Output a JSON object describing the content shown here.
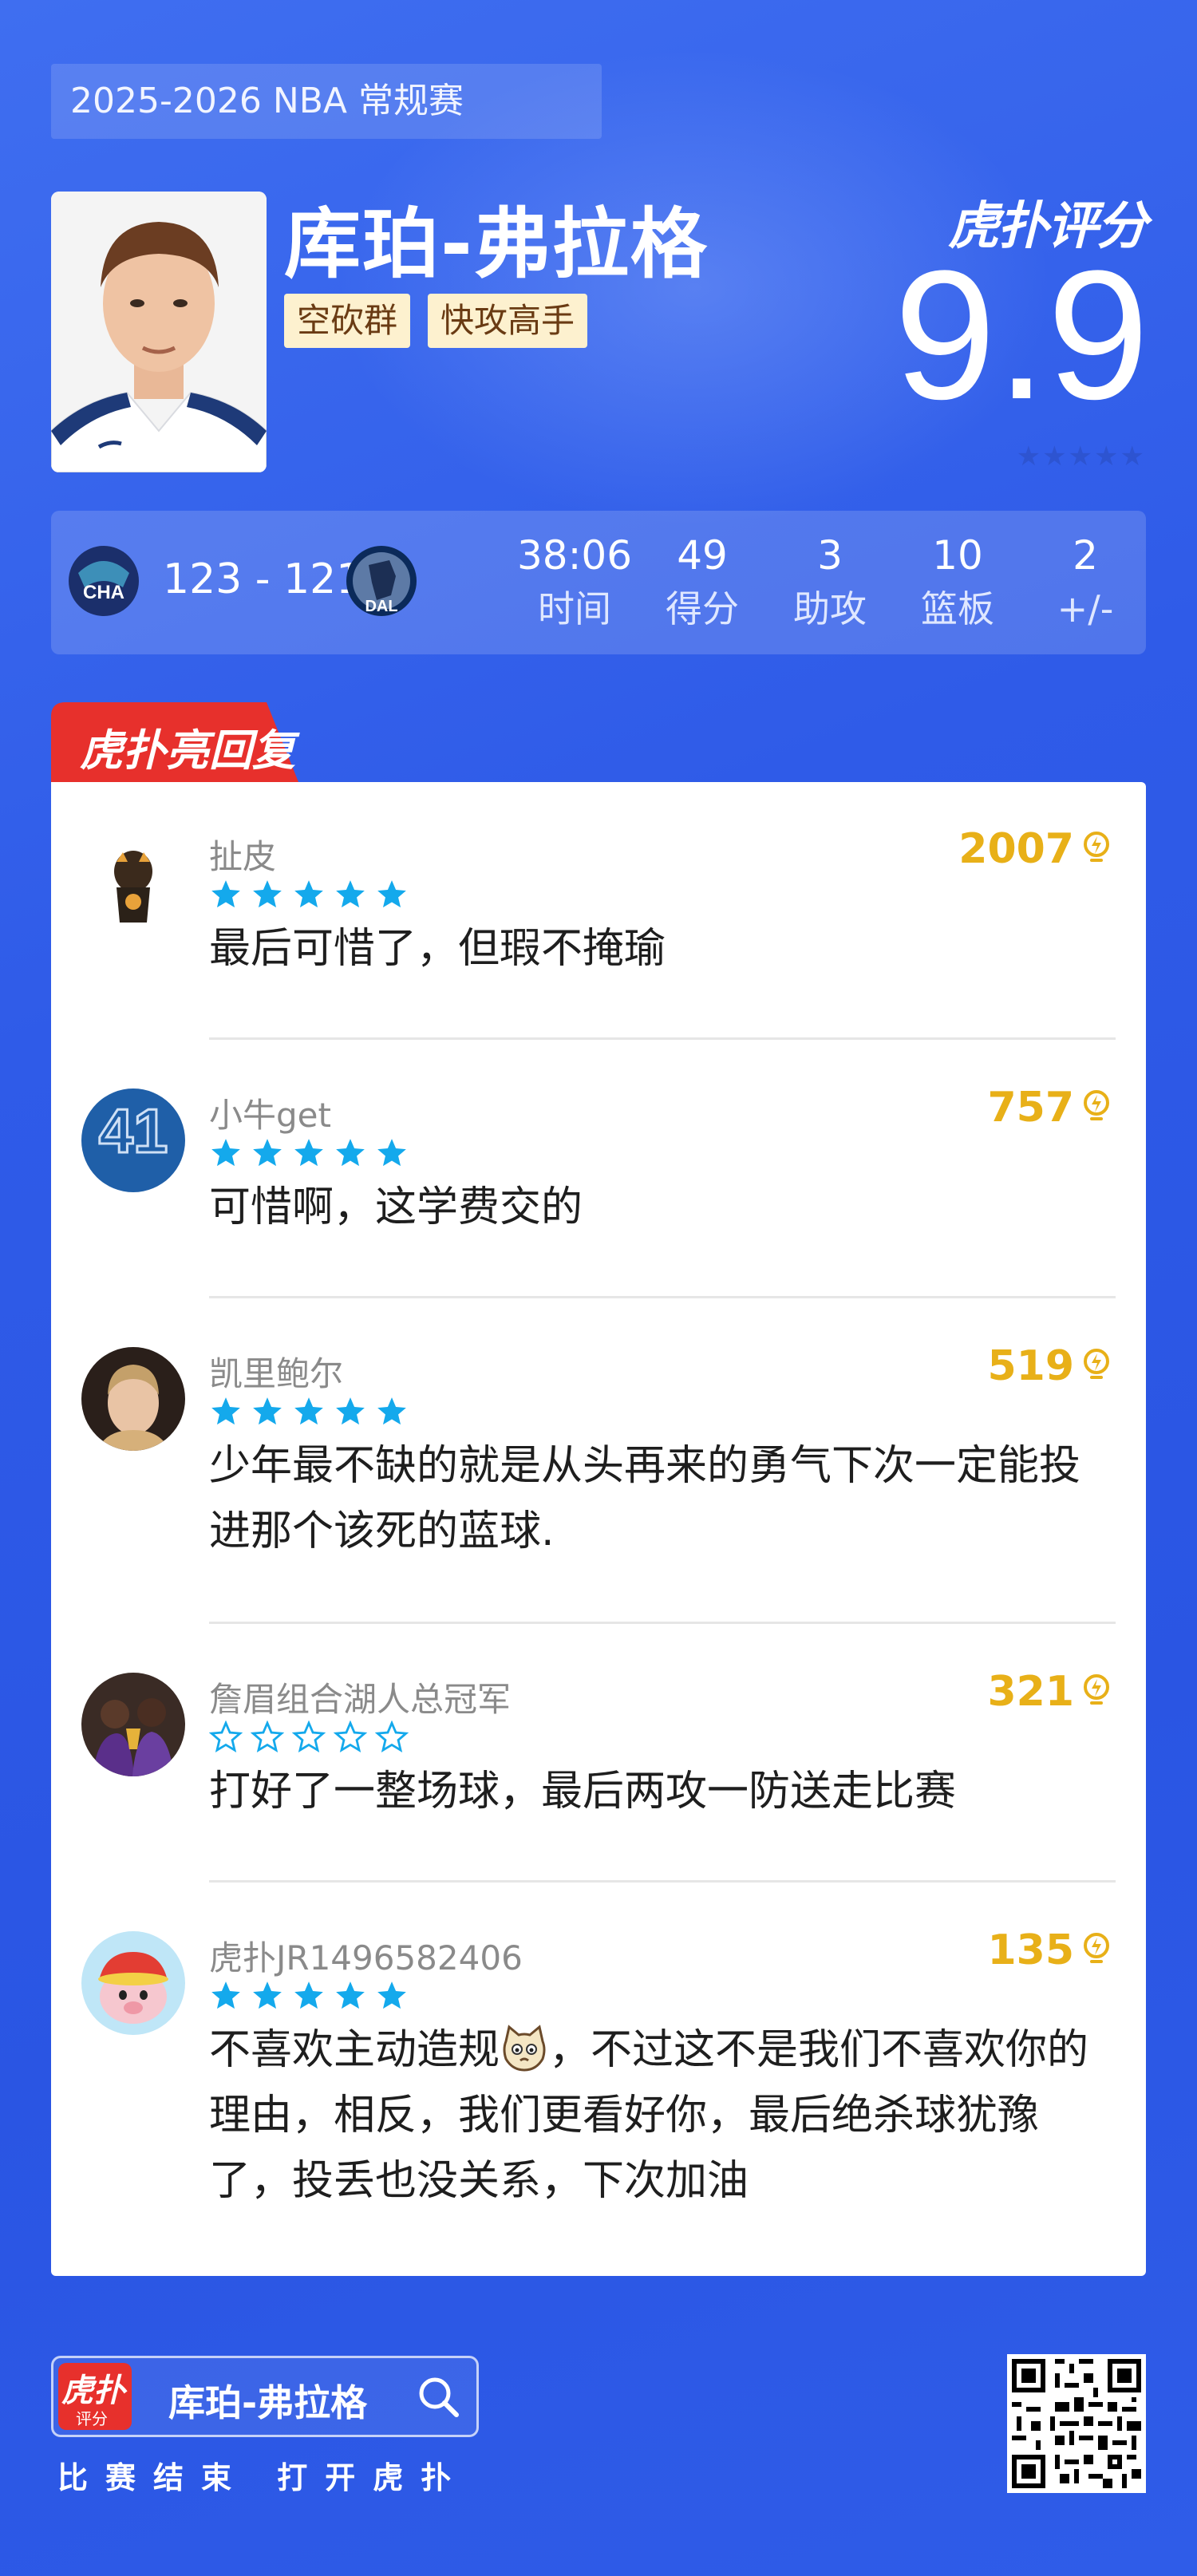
{
  "header": {
    "season": "2025-2026 NBA 常规赛",
    "player_name": "库珀-弗拉格",
    "tags": [
      "空砍群",
      "快攻高手"
    ],
    "rating_brand": "虎扑评分",
    "rating_score": "9.9",
    "rating_stars": "★★★★★"
  },
  "scorebar": {
    "home_team": "CHA",
    "away_team": "DAL",
    "score": "123 - 121",
    "stats": [
      {
        "value": "38:06",
        "label": "时间"
      },
      {
        "value": "49",
        "label": "得分"
      },
      {
        "value": "3",
        "label": "助攻"
      },
      {
        "value": "10",
        "label": "篮板"
      },
      {
        "value": "2",
        "label": "+/-"
      }
    ]
  },
  "replies": {
    "tab_label": "虎扑亮回复",
    "comments": [
      {
        "user": "扯皮",
        "likes": "2007",
        "stars": 5,
        "text": "最后可惜了，但瑕不掩瑜"
      },
      {
        "user": "小牛get",
        "likes": "757",
        "stars": 5,
        "text": "可惜啊，这学费交的"
      },
      {
        "user": "凯里鲍尔",
        "likes": "519",
        "stars": 5,
        "text": "少年最不缺的就是从头再来的勇气下次一定能投进那个该死的蓝球."
      },
      {
        "user": "詹眉组合湖人总冠军",
        "likes": "321",
        "stars": 0,
        "text": "打好了一整场球，最后两攻一防送走比赛"
      },
      {
        "user": "虎扑JR1496582406",
        "likes": "135",
        "stars": 5,
        "text_before": "不喜欢主动造规",
        "text_after": "，不过这不是我们不喜欢你的理由，相反，我们更看好你，最后绝杀球犹豫了，投丢也没关系，下次加油"
      }
    ]
  },
  "footer": {
    "app_logo_top": "虎扑",
    "app_logo_bottom": "评分",
    "search_text": "库珀-弗拉格",
    "caption": "比赛结束 打开虎扑"
  },
  "colors": {
    "background": "#2f5be8",
    "accent_red": "#e7302c",
    "like_gold": "#e8b018",
    "star_blue": "#14a9ec"
  }
}
